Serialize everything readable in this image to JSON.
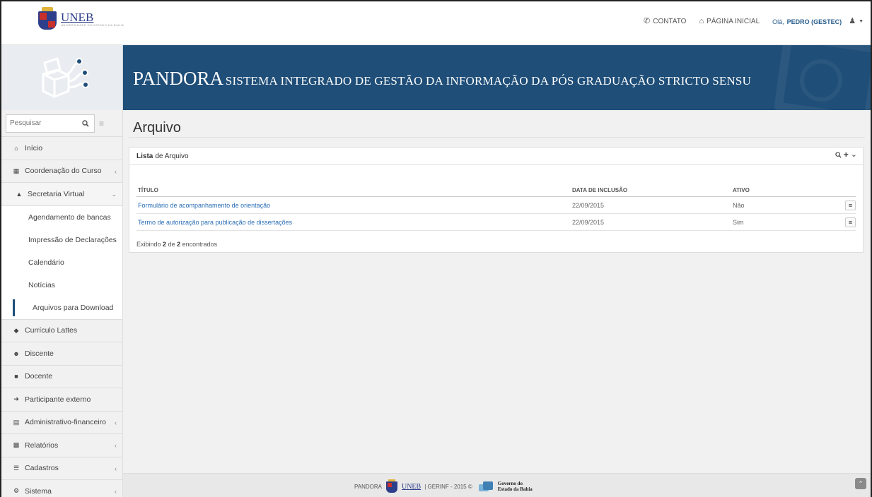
{
  "top": {
    "logo_name": "UNEB",
    "logo_sub": "UNIVERSIDADE DO ESTADO DA BAHIA",
    "contato": "CONTATO",
    "pagina_inicial": "PÁGINA INICIAL",
    "greeting": "Olá,",
    "user_name": "PEDRO (GESTEC)"
  },
  "banner": {
    "title_big": "PANDORA",
    "title_small": "SISTEMA INTEGRADO DE GESTÃO DA INFORMAÇÃO DA PÓS GRADUAÇÃO STRICTO SENSU"
  },
  "sidebar": {
    "search_placeholder": "Pesquisar",
    "items": [
      {
        "label": "Início",
        "icon": "home-icon"
      },
      {
        "label": "Coordenação do Curso",
        "icon": "book-icon"
      },
      {
        "label": "Secretaria Virtual",
        "icon": "bank-icon"
      },
      {
        "label": "Agendamento de bancas"
      },
      {
        "label": "Impressão de Declarações"
      },
      {
        "label": "Calendário"
      },
      {
        "label": "Notícias"
      },
      {
        "label": "Arquivos para Download"
      },
      {
        "label": "Currículo Lattes",
        "icon": "graduation-cap-icon"
      },
      {
        "label": "Discente",
        "icon": "users-icon"
      },
      {
        "label": "Docente",
        "icon": "briefcase-icon"
      },
      {
        "label": "Participante externo",
        "icon": "sign-in-icon"
      },
      {
        "label": "Administrativo-financeiro",
        "icon": "money-icon"
      },
      {
        "label": "Relatórios",
        "icon": "bar-chart-icon"
      },
      {
        "label": "Cadastros",
        "icon": "list-icon"
      },
      {
        "label": "Sistema",
        "icon": "cogs-icon"
      }
    ]
  },
  "main": {
    "page_title": "Arquivo",
    "panel_title_bold": "Lista",
    "panel_title_rest": "de Arquivo",
    "columns": [
      "TÍTULO",
      "DATA DE INCLUSÃO",
      "ATIVO"
    ],
    "rows": [
      {
        "titulo": "Formulário de acompanhamento de orientação",
        "data": "22/09/2015",
        "ativo": "Não"
      },
      {
        "titulo": "Termo de autorização para publicação de dissertações",
        "data": "22/09/2015",
        "ativo": "Sim"
      }
    ],
    "count_prefix": "Exibindo",
    "count_shown": "2",
    "count_mid": "de",
    "count_total": "2",
    "count_suffix": "encontrados"
  },
  "footer": {
    "app": "PANDORA",
    "uneb": "UNEB",
    "credit": "| GERINF - 2015 ©",
    "gov_line1": "Governo do",
    "gov_line2": "Estado da Bahia"
  },
  "colors": {
    "banner": "#1f4e78",
    "link": "#2a6eb5",
    "active_bar": "#1f4e78"
  }
}
